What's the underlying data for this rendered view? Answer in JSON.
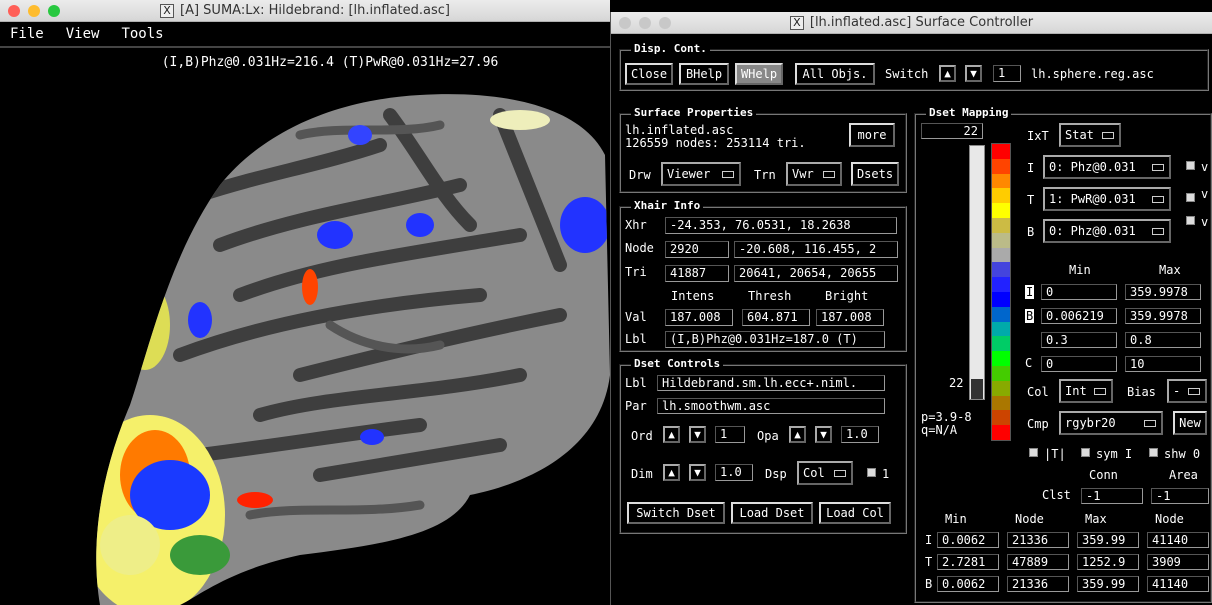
{
  "suma": {
    "title": "[A] SUMA:Lx: Hildebrand: [lh.inflated.asc]",
    "menu": [
      "File",
      "View",
      "Tools"
    ],
    "readout": "(I,B)Phz@0.031Hz=216.4 (T)PwR@0.031Hz=27.96"
  },
  "ctrl": {
    "title": "[lh.inflated.asc] Surface Controller",
    "disp": {
      "legend": "Disp. Cont.",
      "close": "Close",
      "bhelp": "BHelp",
      "whelp": "WHelp",
      "allobjs": "All Objs.",
      "switch": "Switch",
      "num": "1",
      "surf": "lh.sphere.reg.asc"
    },
    "props": {
      "legend": "Surface Properties",
      "name": "lh.inflated.asc",
      "info": "126559 nodes: 253114 tri.",
      "more": "more",
      "drw": "Drw",
      "drw_val": "Viewer",
      "trn": "Trn",
      "trn_val": "Vwr",
      "dsets": "Dsets"
    },
    "xhair": {
      "legend": "Xhair Info",
      "xhr": "Xhr",
      "xhr_val": "-24.353, 76.0531, 18.2638",
      "node": "Node",
      "node_val": "2920",
      "node_xyz": "-20.608, 116.455, 2",
      "tri": "Tri",
      "tri_val": "41887",
      "tri_nodes": "20641, 20654, 20655",
      "intens": "Intens",
      "thresh": "Thresh",
      "bright": "Bright",
      "val": "Val",
      "v1": "187.008",
      "v2": "604.871",
      "v3": "187.008",
      "lbl": "Lbl",
      "lbl_val": "(I,B)Phz@0.031Hz=187.0 (T)"
    },
    "dctrl": {
      "legend": "Dset Controls",
      "lbl": "Lbl",
      "lbl_val": "Hildebrand.sm.lh.ecc+.niml.",
      "par": "Par",
      "par_val": "lh.smoothwm.asc",
      "ord": "Ord",
      "ord_val": "1",
      "opa": "Opa",
      "opa_val": "1.0",
      "dim": "Dim",
      "dim_val": "1.0",
      "dsp": "Dsp",
      "dsp_val": "Col",
      "chk1": "1",
      "switch": "Switch Dset",
      "load": "Load Dset",
      "loadcol": "Load Col"
    },
    "map": {
      "legend": "Dset Mapping",
      "top": "22",
      "bottom": "22",
      "p": "p=3.9-8",
      "q": "q=N/A",
      "ixt": "IxT",
      "ixt_val": "Stat",
      "i": "I",
      "i_val": "0: Phz@0.031",
      "t": "T",
      "t_val": "1: PwR@0.031",
      "b": "B",
      "b_val": "0: Phz@0.031",
      "v": "v",
      "min": "Min",
      "max": "Max",
      "r1": [
        "I",
        "0",
        "359.9978"
      ],
      "r2": [
        "B",
        "0.006219",
        "359.9978"
      ],
      "r3": [
        "",
        "0.3",
        "0.8"
      ],
      "r4": [
        "C",
        "0",
        "10"
      ],
      "col": "Col",
      "col_val": "Int",
      "bias": "Bias",
      "bias_val": "-",
      "cmp": "Cmp",
      "cmp_val": "rgybr20",
      "new": "New",
      "iti": "|T|",
      "symi": "sym I",
      "shw": "shw 0",
      "conn": "Conn",
      "area": "Area",
      "clst": "Clst",
      "c1": "-1",
      "c2": "-1",
      "table": {
        "h": [
          "Min",
          "Node",
          "Max",
          "Node"
        ],
        "rows": [
          [
            "I",
            "0.0062",
            "21336",
            "359.99",
            "41140"
          ],
          [
            "T",
            "2.7281",
            "47889",
            "1252.9",
            "3909"
          ],
          [
            "B",
            "0.0062",
            "21336",
            "359.99",
            "41140"
          ]
        ]
      }
    },
    "colors": [
      "#ff0000",
      "#ff4400",
      "#ff8800",
      "#ffcc00",
      "#ffff00",
      "#ccbb44",
      "#bbbb88",
      "#aaaaaa",
      "#4444dd",
      "#2222ff",
      "#0000ff",
      "#0066cc",
      "#00aaaa",
      "#00cc66",
      "#00ff00",
      "#44cc00",
      "#88aa00",
      "#aa7700",
      "#cc4400",
      "#ff0000"
    ]
  }
}
